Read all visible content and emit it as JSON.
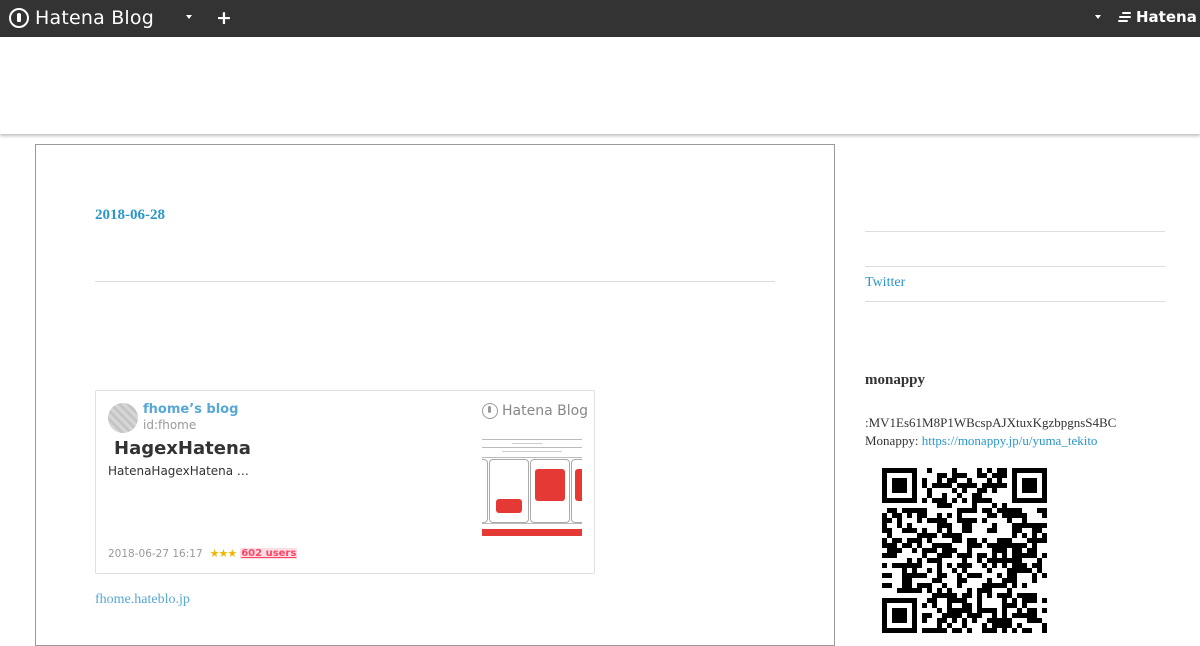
{
  "topbar": {
    "brand": "Hatena Blog",
    "hatena": "Hatena",
    "plus": "+"
  },
  "post": {
    "date": "2018-06-28",
    "card": {
      "blog_name": "fhome’s blog",
      "user_id": "id:fhome",
      "title": "HagexHatena",
      "description": "HatenaHagexHatena …",
      "timestamp": "2018-06-27 16:17",
      "stars": "★★★",
      "users": "602 users",
      "service": "Hatena Blog"
    },
    "source": "fhome.hateblo.jp"
  },
  "sidebar": {
    "twitter": "Twitter",
    "monappy_heading": "monappy",
    "address_line": ":MV1Es61M8P1WBcspAJXtuxKgzbpgnsS4BC",
    "monappy_label": "Monappy: ",
    "monappy_url": "https://monappy.jp/u/yuma_tekito"
  },
  "colors": {
    "topbar": "#333333",
    "link": "#2a95c9",
    "users_badge": "#ff4466"
  }
}
